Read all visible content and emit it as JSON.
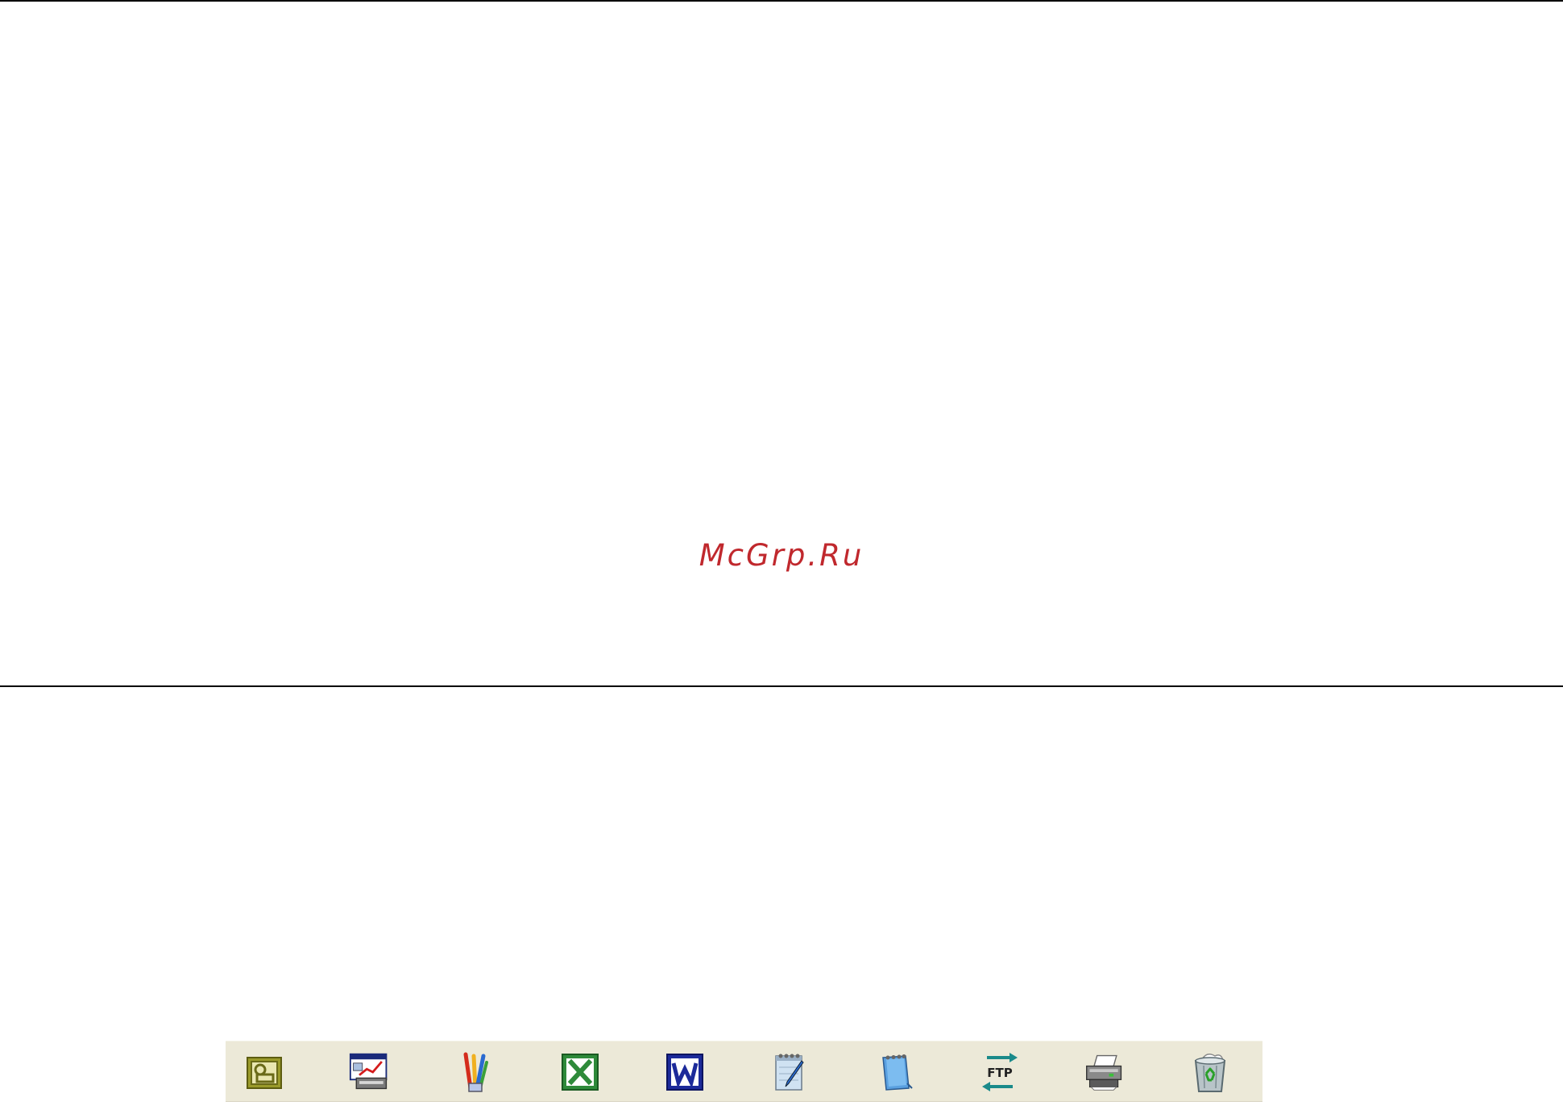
{
  "watermark": {
    "text": "McGrp.Ru",
    "color": "#c0282d"
  },
  "toolbar": {
    "background": "#ece9d8",
    "buttons": [
      {
        "icon": "image-viewer-icon"
      },
      {
        "icon": "presentation-icon"
      },
      {
        "icon": "paint-icon"
      },
      {
        "icon": "spreadsheet-icon"
      },
      {
        "icon": "word-processor-icon"
      },
      {
        "icon": "notepad-icon"
      },
      {
        "icon": "notebook-icon"
      },
      {
        "icon": "ftp-icon",
        "label": "FTP"
      },
      {
        "icon": "printer-icon"
      },
      {
        "icon": "recycle-bin-icon"
      }
    ]
  }
}
